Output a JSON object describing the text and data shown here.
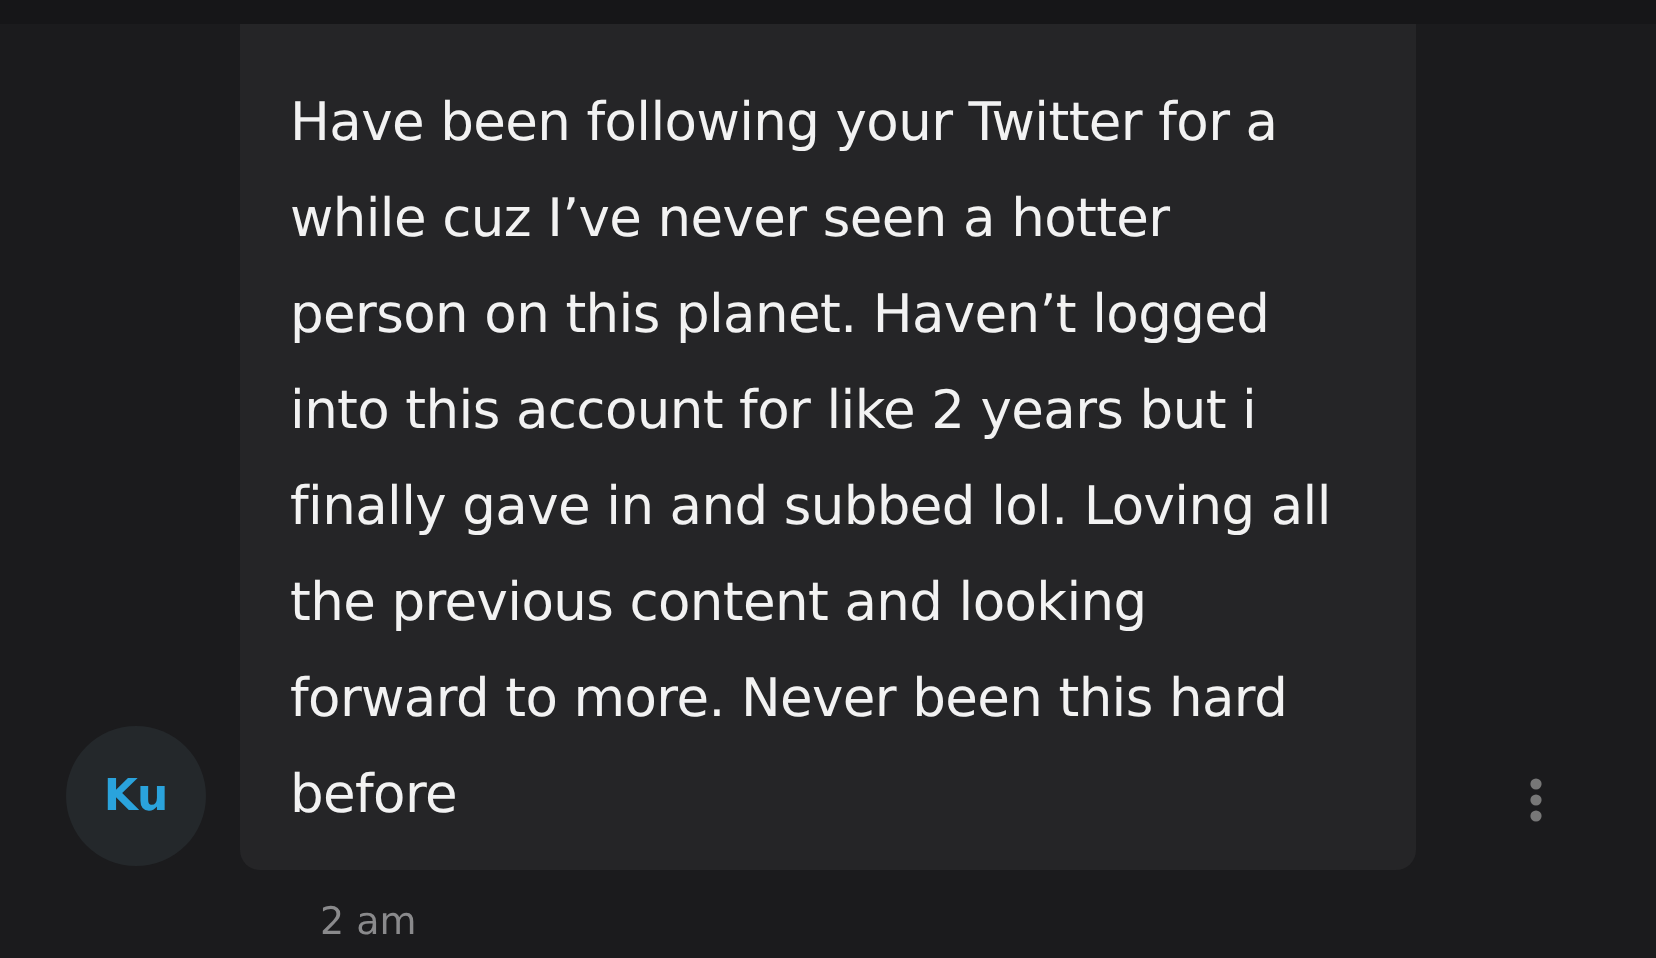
{
  "message": {
    "avatar": "Ku",
    "text": "Have been following your Twitter for a while cuz I’ve never seen a hotter person on this planet. Haven’t logged into this account for like 2 years but i finally gave in and subbed lol. Loving all the previous content and looking forward to more. Never been this hard before",
    "time": "2 am"
  }
}
